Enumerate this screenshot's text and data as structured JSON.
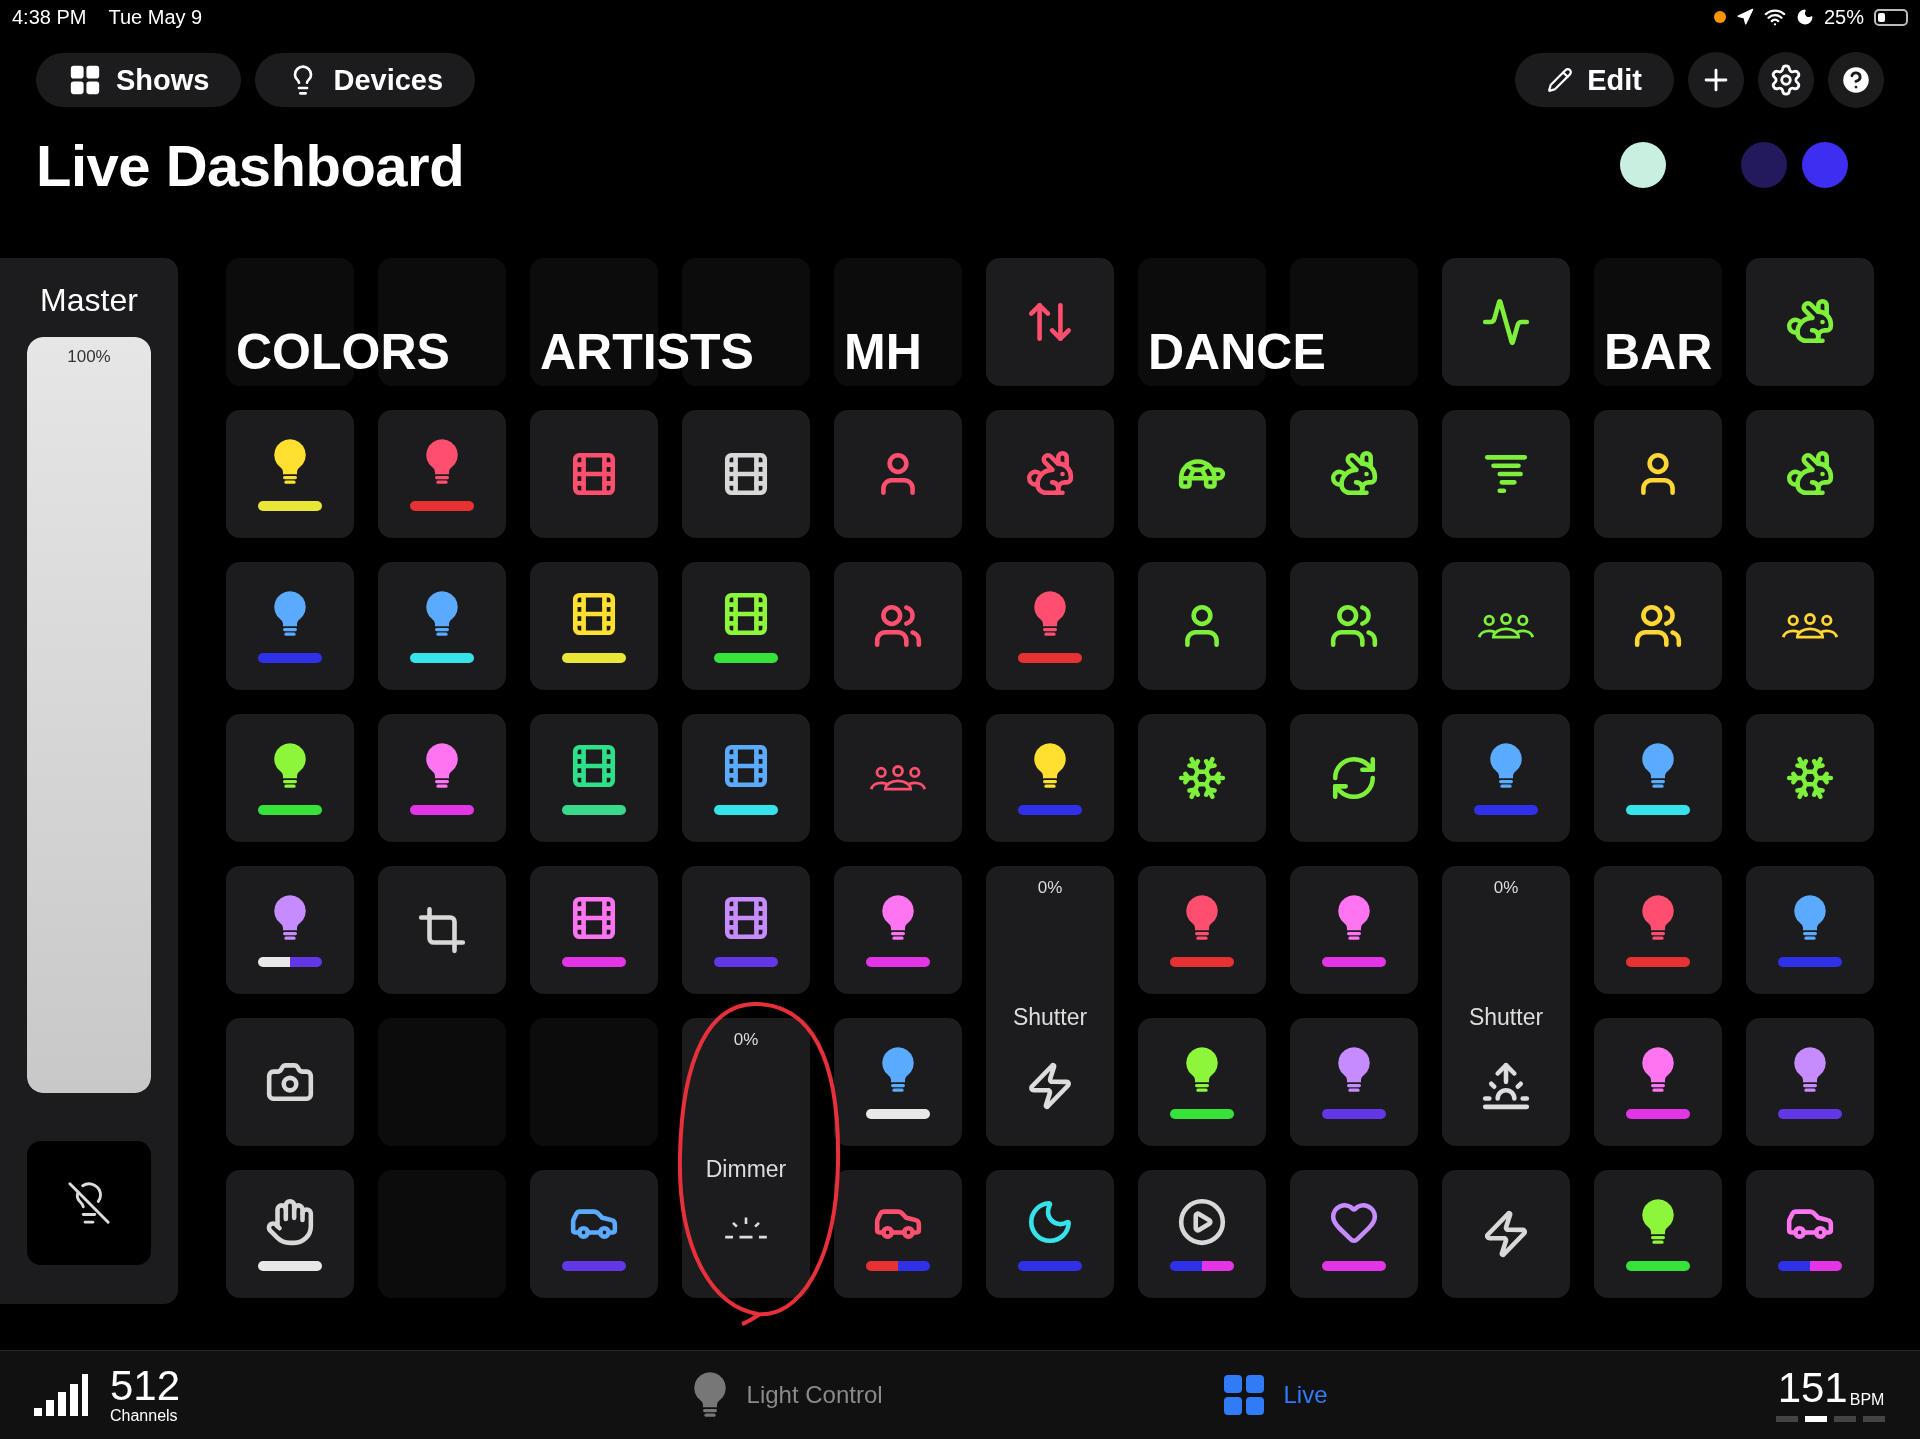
{
  "status_bar": {
    "time": "4:38 PM",
    "date": "Tue May 9",
    "battery": "25%"
  },
  "nav_buttons": [
    {
      "label": "Shows"
    },
    {
      "label": "Devices"
    }
  ],
  "edit_button": {
    "label": "Edit"
  },
  "title": "Live Dashboard",
  "swatches": [
    {
      "color": "#c9efe1"
    },
    {
      "color": "#221a5c"
    },
    {
      "color": "#3d2ef2"
    }
  ],
  "master": {
    "label": "Master",
    "reading": "100%",
    "level": 1
  },
  "header": [
    {
      "kind": "label",
      "text": "COLORS"
    },
    {
      "kind": "blank"
    },
    {
      "kind": "label",
      "text": "ARTISTS"
    },
    {
      "kind": "blank"
    },
    {
      "kind": "label",
      "text": "MH"
    },
    {
      "kind": "icon",
      "color": "#ff4f6e"
    },
    {
      "kind": "label",
      "text": "DANCE"
    },
    {
      "kind": "blank"
    },
    {
      "kind": "icon",
      "color": "#7ef03c"
    },
    {
      "kind": "label",
      "text": "BAR"
    },
    {
      "kind": "icon",
      "color": "#7ef03c"
    }
  ],
  "tiles": [
    {
      "kind": "icon",
      "color": "#ffe030",
      "bars": [
        {
          "color": "#e8e637"
        }
      ]
    },
    {
      "kind": "icon",
      "color": "#ff4f6e",
      "bars": [
        {
          "color": "#e63232"
        }
      ]
    },
    {
      "kind": "icon",
      "color": "#ff4f6e"
    },
    {
      "kind": "icon",
      "color": "#d8d8d8"
    },
    {
      "kind": "icon",
      "color": "#ff4f6e"
    },
    {
      "kind": "icon",
      "color": "#ff4f6e"
    },
    {
      "kind": "icon",
      "color": "#7ef03c"
    },
    {
      "kind": "icon",
      "color": "#7ef03c"
    },
    {
      "kind": "icon",
      "color": "#7ef03c"
    },
    {
      "kind": "icon",
      "color": "#ffd633"
    },
    {
      "kind": "icon",
      "color": "#7ef03c"
    },
    {
      "kind": "icon",
      "color": "#5aabff",
      "bars": [
        {
          "color": "#3030e8"
        }
      ]
    },
    {
      "kind": "icon",
      "color": "#5aabff",
      "bars": [
        {
          "color": "#36e3ea"
        }
      ]
    },
    {
      "kind": "icon",
      "color": "#ffe030",
      "bars": [
        {
          "color": "#e8e637"
        }
      ]
    },
    {
      "kind": "icon",
      "color": "#8df53a",
      "bars": [
        {
          "color": "#37e33a"
        }
      ]
    },
    {
      "kind": "icon",
      "color": "#ff4f6e"
    },
    {
      "kind": "icon",
      "color": "#ff4f6e",
      "bars": [
        {
          "color": "#e63232"
        }
      ]
    },
    {
      "kind": "icon",
      "color": "#7ef03c"
    },
    {
      "kind": "icon",
      "color": "#7ef03c"
    },
    {
      "kind": "icon",
      "color": "#7ef03c"
    },
    {
      "kind": "icon",
      "color": "#ffd633"
    },
    {
      "kind": "icon",
      "color": "#ffd633"
    },
    {
      "kind": "icon",
      "color": "#8df53a",
      "bars": [
        {
          "color": "#37e33a"
        }
      ]
    },
    {
      "kind": "icon",
      "color": "#ff75f1",
      "bars": [
        {
          "color": "#e236e6"
        }
      ]
    },
    {
      "kind": "icon",
      "color": "#2ee08a",
      "bars": [
        {
          "color": "#37d98a"
        }
      ]
    },
    {
      "kind": "icon",
      "color": "#5aabff",
      "bars": [
        {
          "color": "#36e3ea"
        }
      ]
    },
    {
      "kind": "icon",
      "color": "#ff4f6e"
    },
    {
      "kind": "icon",
      "color": "#ffe030",
      "bars": [
        {
          "color": "#3030e8"
        }
      ]
    },
    {
      "kind": "icon",
      "color": "#7ef03c"
    },
    {
      "kind": "icon",
      "color": "#7ef03c"
    },
    {
      "kind": "icon",
      "color": "#5aabff",
      "bars": [
        {
          "color": "#3030e8"
        }
      ]
    },
    {
      "kind": "icon",
      "color": "#5aabff",
      "bars": [
        {
          "color": "#36e3ea"
        }
      ]
    },
    {
      "kind": "icon",
      "color": "#7ef03c"
    },
    {
      "kind": "icon",
      "color": "#c58bff",
      "bars": [
        {
          "color": "#e8e8e8"
        },
        {
          "color": "#6336e6"
        }
      ]
    },
    {
      "kind": "icon",
      "color": "#d8d8d8"
    },
    {
      "kind": "icon",
      "color": "#ff75f1",
      "bars": [
        {
          "color": "#e236e6"
        }
      ]
    },
    {
      "kind": "icon",
      "color": "#c58bff",
      "bars": [
        {
          "color": "#6336e6"
        }
      ]
    },
    {
      "kind": "icon",
      "color": "#ff75f1",
      "bars": [
        {
          "color": "#e236e6"
        }
      ]
    },
    {
      "kind": "fader",
      "label": "Shutter",
      "reading": "0%"
    },
    {
      "kind": "icon",
      "color": "#ff4f6e",
      "bars": [
        {
          "color": "#e63232"
        }
      ]
    },
    {
      "kind": "icon",
      "color": "#ff75f1",
      "bars": [
        {
          "color": "#e236e6"
        }
      ]
    },
    {
      "kind": "fader",
      "label": "Shutter",
      "reading": "0%"
    },
    {
      "kind": "icon",
      "color": "#ff4f6e",
      "bars": [
        {
          "color": "#e63232"
        }
      ]
    },
    {
      "kind": "icon",
      "color": "#5aabff",
      "bars": [
        {
          "color": "#3030e8"
        }
      ]
    },
    {
      "kind": "icon",
      "color": "#d8d8d8"
    },
    {
      "kind": "empty"
    },
    {
      "kind": "empty"
    },
    {
      "kind": "fader",
      "label": "Dimmer",
      "reading": "0%",
      "circled": true
    },
    {
      "kind": "icon",
      "color": "#5aabff",
      "bars": [
        {
          "color": "#e8e8e8"
        }
      ]
    },
    {
      "kind": "icon",
      "color": "#8df53a",
      "bars": [
        {
          "color": "#37e33a"
        }
      ]
    },
    {
      "kind": "icon",
      "color": "#c58bff",
      "bars": [
        {
          "color": "#6336e6"
        }
      ]
    },
    {
      "kind": "icon",
      "color": "#ff75f1",
      "bars": [
        {
          "color": "#e236e6"
        }
      ]
    },
    {
      "kind": "icon",
      "color": "#c58bff",
      "bars": [
        {
          "color": "#6336e6"
        }
      ]
    },
    {
      "kind": "icon",
      "color": "#d8d8d8",
      "bars": [
        {
          "color": "#e8e8e8"
        }
      ]
    },
    {
      "kind": "empty"
    },
    {
      "kind": "icon",
      "color": "#5aabff",
      "bars": [
        {
          "color": "#6336e6"
        }
      ]
    },
    {
      "kind": "icon",
      "color": "#ff4f6e",
      "bars": [
        {
          "color": "#e63232"
        },
        {
          "color": "#3030e8"
        }
      ]
    },
    {
      "kind": "icon",
      "color": "#36e3ea",
      "bars": [
        {
          "color": "#3030e8"
        }
      ]
    },
    {
      "kind": "icon",
      "color": "#d8d8d8",
      "bars": [
        {
          "color": "#3030e8"
        },
        {
          "color": "#e236e6"
        }
      ]
    },
    {
      "kind": "icon",
      "color": "#c58bff",
      "bars": [
        {
          "color": "#e236e6"
        }
      ]
    },
    {
      "kind": "icon",
      "color": "#d8d8d8"
    },
    {
      "kind": "icon",
      "color": "#8df53a",
      "bars": [
        {
          "color": "#37e33a"
        }
      ]
    },
    {
      "kind": "icon",
      "color": "#ff75f1",
      "bars": [
        {
          "color": "#3030e8"
        },
        {
          "color": "#e236e6"
        }
      ]
    }
  ],
  "footer": {
    "channels": "512",
    "channels_label": "Channels",
    "bpm": "151",
    "bpm_unit": "BPM",
    "tabs": [
      {
        "label": "Light Control",
        "selected": false
      },
      {
        "label": "Live",
        "selected": true
      }
    ]
  }
}
